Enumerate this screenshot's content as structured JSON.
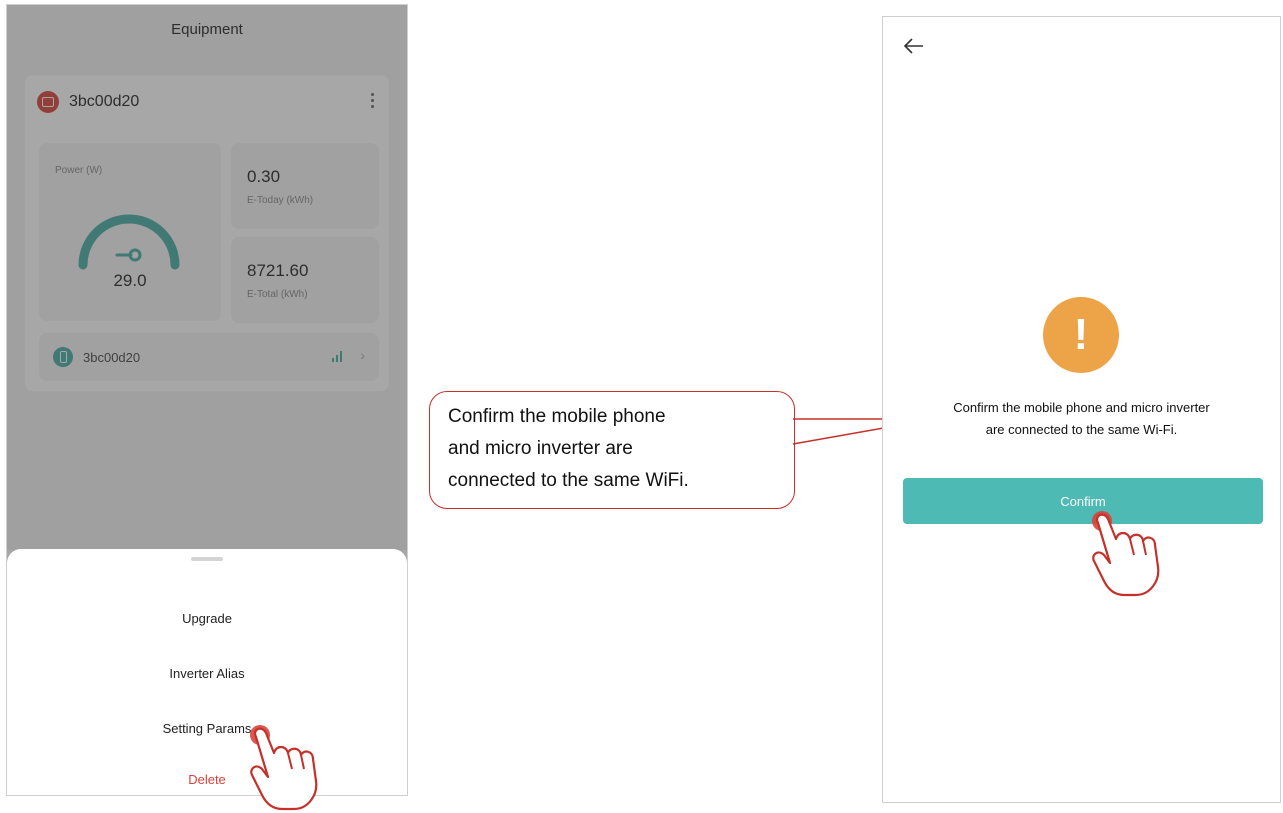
{
  "left_screen": {
    "title": "Equipment",
    "device": {
      "id": "3bc00d20",
      "power": {
        "label": "Power  (W)",
        "value": "29.0"
      },
      "stats": [
        {
          "value": "0.30",
          "label": "E-Today  (kWh)"
        },
        {
          "value": "8721.60",
          "label": "E-Total  (kWh)"
        }
      ],
      "sub_device": {
        "id": "3bc00d20"
      }
    },
    "action_sheet": {
      "items": [
        {
          "label": "Upgrade"
        },
        {
          "label": "Inverter Alias"
        },
        {
          "label": "Setting Params"
        },
        {
          "label": "Delete"
        }
      ]
    }
  },
  "callout": {
    "lines": [
      "Confirm the mobile phone",
      "and micro inverter are",
      "connected to the same WiFi."
    ]
  },
  "right_screen": {
    "message_lines": [
      "Confirm the mobile phone and micro inverter",
      "are connected to the same Wi-Fi."
    ],
    "confirm_label": "Confirm"
  },
  "colors": {
    "accent_teal": "#4dbab3",
    "warning_orange": "#eda347",
    "delete_red": "#d9423a",
    "callout_red": "#c5302a"
  },
  "icons": [
    "back-arrow-icon",
    "warning-icon",
    "device-icon",
    "kebab-menu-icon",
    "signal-icon",
    "chevron-right-icon",
    "hand-pointer-icon"
  ]
}
